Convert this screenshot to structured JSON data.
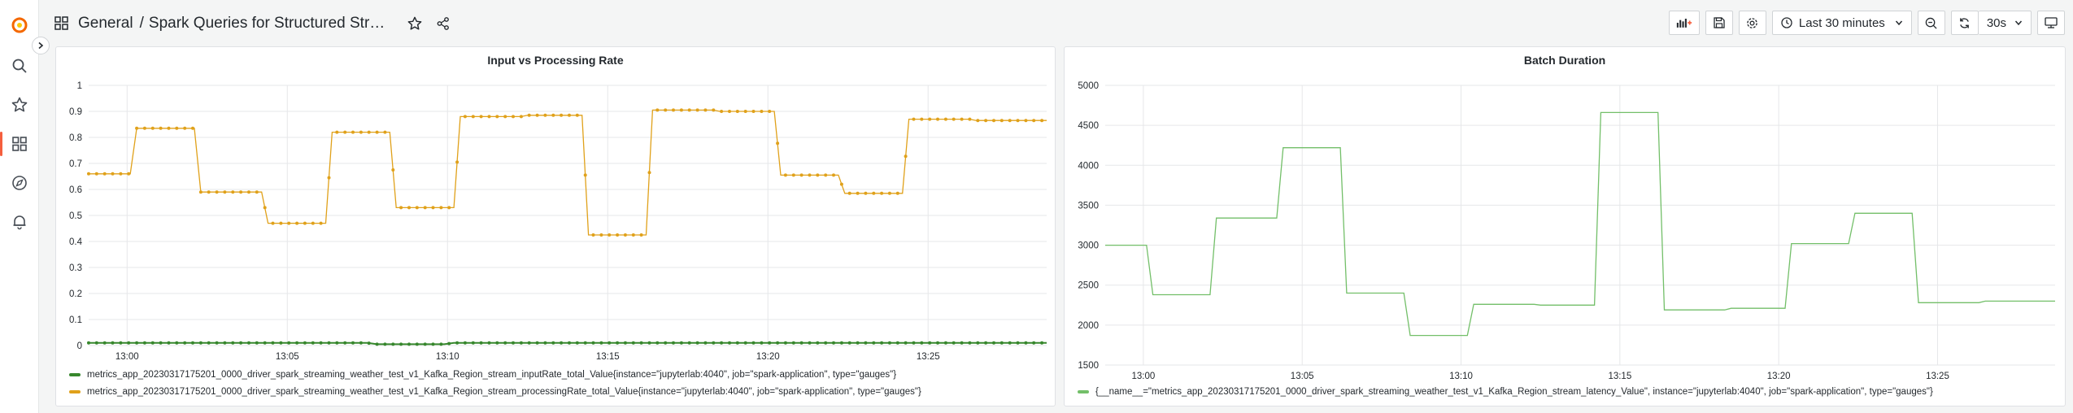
{
  "header": {
    "folder": "General",
    "separator": "/",
    "title": "Spark Queries for Structured Streami...",
    "time_range": "Last 30 minutes",
    "refresh_interval": "30s"
  },
  "colors": {
    "green": "#37872d",
    "yellow": "#e0a11a",
    "line_green": "#73bf69",
    "active": "#f55f3e"
  },
  "icons": [
    "grafana-logo-icon",
    "search-icon",
    "star-icon",
    "dashboards-icon",
    "explore-icon",
    "alerting-icon",
    "star-outline-icon",
    "share-icon",
    "add-panel-icon",
    "save-icon",
    "settings-icon",
    "clock-icon",
    "chevron-down-icon",
    "zoom-out-icon",
    "refresh-icon",
    "tv-icon"
  ],
  "panels": [
    {
      "title": "Input vs Processing Rate",
      "legend": [
        "metrics_app_20230317175201_0000_driver_spark_streaming_weather_test_v1_Kafka_Region_stream_inputRate_total_Value{instance=\"jupyterlab:4040\", job=\"spark-application\", type=\"gauges\"}",
        "metrics_app_20230317175201_0000_driver_spark_streaming_weather_test_v1_Kafka_Region_stream_processingRate_total_Value{instance=\"jupyterlab:4040\", job=\"spark-application\", type=\"gauges\"}"
      ]
    },
    {
      "title": "Batch Duration",
      "legend": [
        "{__name__=\"metrics_app_20230317175201_0000_driver_spark_streaming_weather_test_v1_Kafka_Region_stream_latency_Value\", instance=\"jupyterlab:4040\", job=\"spark-application\", type=\"gauges\"}"
      ]
    }
  ],
  "chart_data": [
    {
      "type": "line",
      "title": "Input vs Processing Rate",
      "x_unit": "minutes (clock time)",
      "xlim": [
        58.8,
        88.7
      ],
      "ylim": [
        0,
        1
      ],
      "yticks": [
        0,
        0.1,
        0.2,
        0.3,
        0.4,
        0.5,
        0.6,
        0.7,
        0.8,
        0.9,
        1
      ],
      "xticks": [
        "13:00",
        "13:05",
        "13:10",
        "13:15",
        "13:20",
        "13:25"
      ],
      "xtick_minutes": [
        60,
        65,
        70,
        75,
        80,
        85
      ],
      "grid": true,
      "legend_position": "bottom-left",
      "series": [
        {
          "name": "metrics_app_20230317175201_0000_driver_spark_streaming_weather_test_v1_Kafka_Region_stream_inputRate_total_Value{instance=\"jupyterlab:4040\", job=\"spark-application\", type=\"gauges\"}",
          "color": "#37872d",
          "points": [
            [
              58.8,
              0.01
            ],
            [
              67.5,
              0.01
            ],
            [
              67.8,
              0.005
            ],
            [
              69.9,
              0.005
            ],
            [
              70.2,
              0.01
            ],
            [
              88.7,
              0.01
            ]
          ]
        },
        {
          "name": "metrics_app_20230317175201_0000_driver_spark_streaming_weather_test_v1_Kafka_Region_stream_processingRate_total_Value{instance=\"jupyterlab:4040\", job=\"spark-application\", type=\"gauges\"}",
          "color": "#e0a11a",
          "points": [
            [
              58.8,
              0.66
            ],
            [
              60.1,
              0.66
            ],
            [
              60.3,
              0.835
            ],
            [
              62.1,
              0.835
            ],
            [
              62.3,
              0.59
            ],
            [
              64.2,
              0.59
            ],
            [
              64.4,
              0.47
            ],
            [
              66.2,
              0.47
            ],
            [
              66.4,
              0.82
            ],
            [
              68.2,
              0.82
            ],
            [
              68.4,
              0.53
            ],
            [
              70.2,
              0.53
            ],
            [
              70.4,
              0.88
            ],
            [
              72.3,
              0.88
            ],
            [
              72.5,
              0.885
            ],
            [
              74.2,
              0.885
            ],
            [
              74.4,
              0.425
            ],
            [
              76.2,
              0.425
            ],
            [
              76.4,
              0.905
            ],
            [
              78.3,
              0.905
            ],
            [
              78.5,
              0.9
            ],
            [
              80.2,
              0.9
            ],
            [
              80.4,
              0.655
            ],
            [
              82.2,
              0.655
            ],
            [
              82.4,
              0.585
            ],
            [
              84.2,
              0.585
            ],
            [
              84.4,
              0.87
            ],
            [
              86.3,
              0.87
            ],
            [
              86.5,
              0.865
            ],
            [
              88.7,
              0.865
            ]
          ]
        }
      ]
    },
    {
      "type": "line",
      "title": "Batch Duration",
      "x_unit": "minutes (clock time)",
      "xlim": [
        58.8,
        88.7
      ],
      "ylim": [
        1500,
        5000
      ],
      "yticks": [
        1500,
        2000,
        2500,
        3000,
        3500,
        4000,
        4500,
        5000
      ],
      "xticks": [
        "13:00",
        "13:05",
        "13:10",
        "13:15",
        "13:20",
        "13:25"
      ],
      "xtick_minutes": [
        60,
        65,
        70,
        75,
        80,
        85
      ],
      "grid": true,
      "legend_position": "bottom-left",
      "series": [
        {
          "name": "{__name__=\"metrics_app_20230317175201_0000_driver_spark_streaming_weather_test_v1_Kafka_Region_stream_latency_Value\", instance=\"jupyterlab:4040\", job=\"spark-application\", type=\"gauges\"}",
          "color": "#73bf69",
          "points": [
            [
              58.8,
              3000
            ],
            [
              60.1,
              3000
            ],
            [
              60.3,
              2380
            ],
            [
              62.1,
              2380
            ],
            [
              62.3,
              3340
            ],
            [
              64.2,
              3340
            ],
            [
              64.4,
              4220
            ],
            [
              66.2,
              4220
            ],
            [
              66.4,
              2400
            ],
            [
              68.2,
              2400
            ],
            [
              68.4,
              1870
            ],
            [
              70.2,
              1870
            ],
            [
              70.4,
              2260
            ],
            [
              72.3,
              2260
            ],
            [
              72.5,
              2250
            ],
            [
              74.2,
              2250
            ],
            [
              74.4,
              4660
            ],
            [
              76.2,
              4660
            ],
            [
              76.4,
              2190
            ],
            [
              78.3,
              2190
            ],
            [
              78.5,
              2210
            ],
            [
              80.2,
              2210
            ],
            [
              80.4,
              3020
            ],
            [
              82.2,
              3020
            ],
            [
              82.4,
              3400
            ],
            [
              84.2,
              3400
            ],
            [
              84.4,
              2280
            ],
            [
              86.3,
              2280
            ],
            [
              86.5,
              2300
            ],
            [
              88.7,
              2300
            ]
          ]
        }
      ]
    }
  ]
}
